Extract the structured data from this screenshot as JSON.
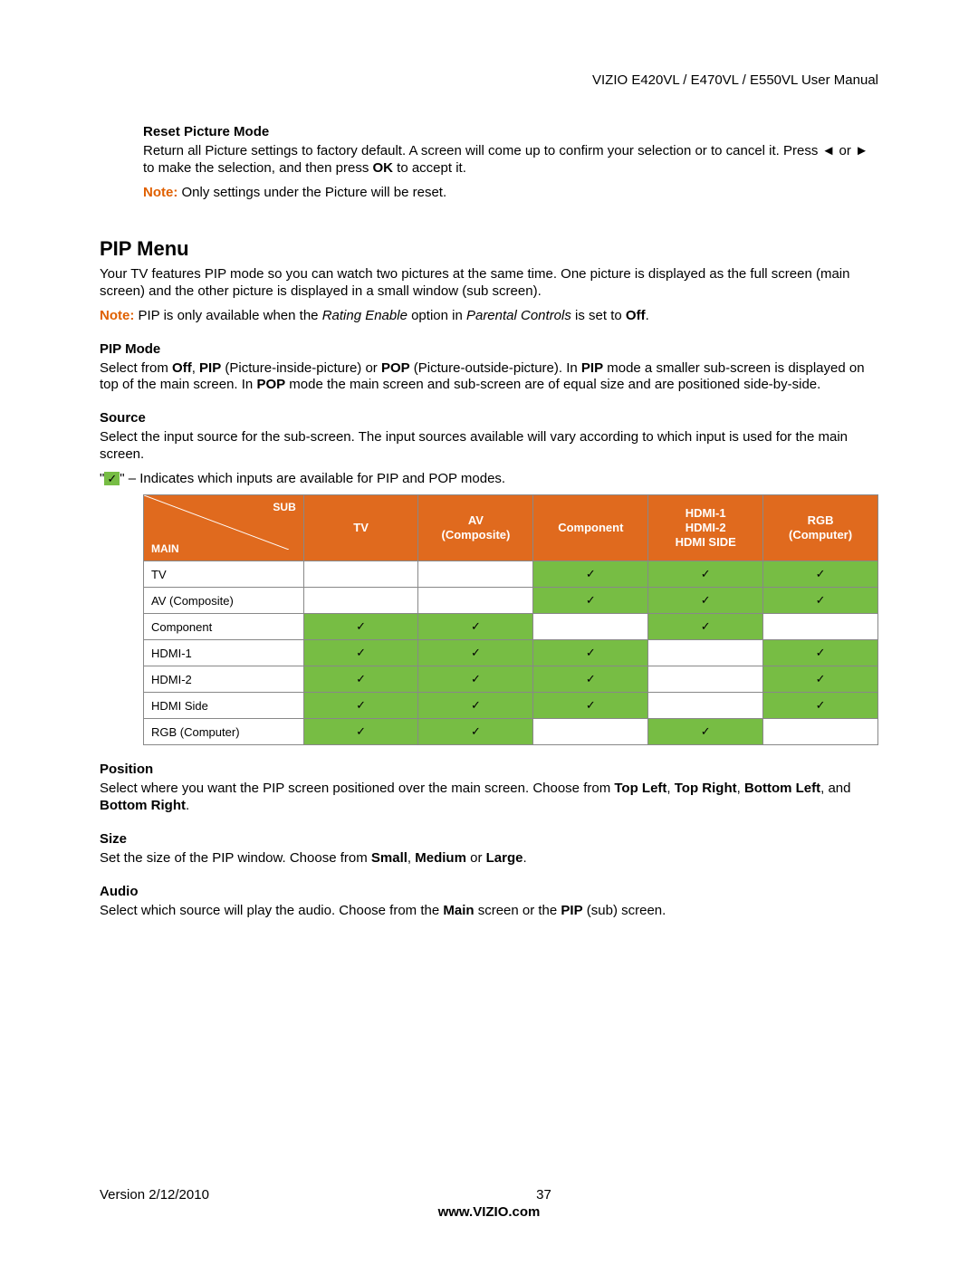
{
  "header": {
    "title": "VIZIO E420VL / E470VL / E550VL User Manual"
  },
  "reset": {
    "heading": "Reset Picture Mode",
    "body_a": "Return all Picture settings to factory default. A screen will come up to confirm your selection or to cancel it. Press ",
    "left": "◄",
    "or": " or ",
    "right": "►",
    "body_b": " to make the selection, and then press ",
    "ok": "OK",
    "body_c": " to accept it.",
    "note_label": "Note:",
    "note_text": " Only settings under the Picture will be reset."
  },
  "pip": {
    "heading": "PIP Menu",
    "intro": "Your TV features PIP mode so you can watch two pictures at the same time. One picture is displayed as the full screen (main screen) and the other picture is displayed in a small window (sub screen).",
    "note_label": "Note:",
    "note_a": " PIP is only available when the ",
    "note_i1": "Rating Enable",
    "note_b": " option in ",
    "note_i2": "Parental Controls",
    "note_c": " is set to ",
    "note_off": "Off",
    "note_d": "."
  },
  "mode": {
    "heading": "PIP Mode",
    "a": "Select from ",
    "off": "Off",
    "b": ", ",
    "pip": "PIP",
    "c": " (Picture-inside-picture) or ",
    "pop": "POP",
    "d": " (Picture-outside-picture). In ",
    "pip2": "PIP",
    "e": " mode a smaller sub-screen is displayed on top of the main screen. In ",
    "pop2": "POP",
    "f": " mode the main screen and sub-screen are of equal size and are positioned side-by-side."
  },
  "source": {
    "heading": "Source",
    "body": "Select the input source for the sub-screen. The input sources available will vary according to which input is used for the main screen.",
    "legend_a": "\"",
    "legend_check": "✓",
    "legend_b": "\" – Indicates which inputs are available for PIP and POP modes."
  },
  "table": {
    "diag_sub": "SUB",
    "diag_main": "MAIN",
    "cols": [
      "TV",
      "AV\n(Composite)",
      "Component",
      "HDMI-1\nHDMI-2\nHDMI SIDE",
      "RGB\n(Computer)"
    ],
    "rows": [
      {
        "label": "TV",
        "cells": [
          0,
          0,
          1,
          1,
          1
        ]
      },
      {
        "label": "AV (Composite)",
        "cells": [
          0,
          0,
          1,
          1,
          1
        ]
      },
      {
        "label": "Component",
        "cells": [
          1,
          1,
          0,
          1,
          0
        ]
      },
      {
        "label": "HDMI-1",
        "cells": [
          1,
          1,
          1,
          0,
          1
        ]
      },
      {
        "label": "HDMI-2",
        "cells": [
          1,
          1,
          1,
          0,
          1
        ]
      },
      {
        "label": "HDMI Side",
        "cells": [
          1,
          1,
          1,
          0,
          1
        ]
      },
      {
        "label": "RGB (Computer)",
        "cells": [
          1,
          1,
          0,
          1,
          0
        ]
      }
    ],
    "check": "✓"
  },
  "position": {
    "heading": "Position",
    "a": "Select where you want the PIP screen positioned over the main screen. Choose from ",
    "b1": "Top Left",
    "c1": ", ",
    "b2": "Top Right",
    "c2": ", ",
    "b3": "Bottom Left",
    "c3": ", and ",
    "b4": "Bottom Right",
    "c4": "."
  },
  "size": {
    "heading": "Size",
    "a": "Set the size of the PIP window. Choose from ",
    "b1": "Small",
    "c1": ", ",
    "b2": "Medium",
    "c2": " or ",
    "b3": "Large",
    "c3": "."
  },
  "audio": {
    "heading": "Audio",
    "a": "Select which source will play the audio. Choose from the ",
    "b1": "Main",
    "c1": " screen or the ",
    "b2": "PIP",
    "c2": " (sub) screen."
  },
  "footer": {
    "version": "Version 2/12/2010",
    "page": "37",
    "url": "www.VIZIO.com"
  }
}
